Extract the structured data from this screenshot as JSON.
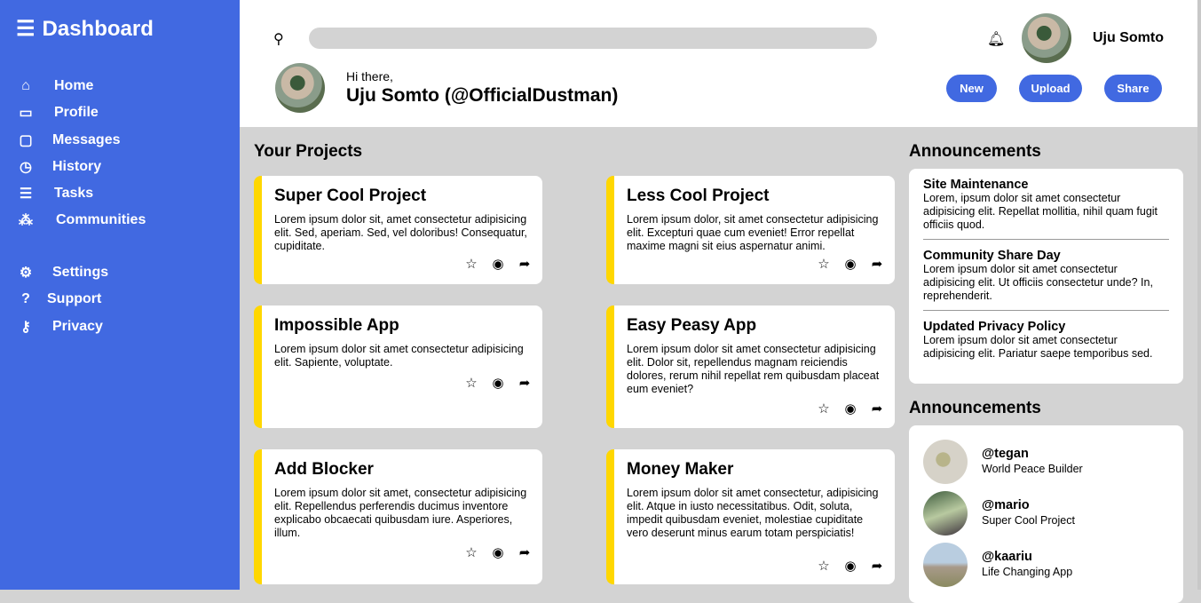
{
  "sidebar": {
    "title": "Dashboard",
    "menu_icon": "hamburger-icon",
    "items": [
      {
        "label": "Home",
        "icon": "home-icon"
      },
      {
        "label": "Profile",
        "icon": "id-card-icon"
      },
      {
        "label": "Messages",
        "icon": "message-icon"
      },
      {
        "label": "History",
        "icon": "clock-icon"
      },
      {
        "label": "Tasks",
        "icon": "tasks-icon"
      },
      {
        "label": "Communities",
        "icon": "people-icon"
      }
    ],
    "secondary": [
      {
        "label": "Settings",
        "icon": "gear-icon"
      },
      {
        "label": "Support",
        "icon": "question-icon"
      },
      {
        "label": "Privacy",
        "icon": "key-icon"
      }
    ]
  },
  "header": {
    "search_placeholder": "",
    "user_name": "Uju Somto",
    "greeting": "Hi there,",
    "full_name": "Uju Somto (@OfficialDustman)",
    "buttons": [
      "New",
      "Upload",
      "Share"
    ]
  },
  "projects": {
    "title": "Your Projects",
    "items": [
      {
        "title": "Super Cool Project",
        "desc": "Lorem ipsum dolor sit, amet consectetur adipisicing elit. Sed, aperiam. Sed, vel doloribus! Consequatur, cupiditate."
      },
      {
        "title": "Less Cool Project",
        "desc": "Lorem ipsum dolor, sit amet consectetur adipisicing elit. Excepturi quae cum eveniet! Error repellat maxime magni sit eius aspernatur animi."
      },
      {
        "title": "Impossible App",
        "desc": "Lorem ipsum dolor sit amet consectetur adipisicing elit. Sapiente, voluptate."
      },
      {
        "title": "Easy Peasy App",
        "desc": "Lorem ipsum dolor sit amet consectetur adipisicing elit. Dolor sit, repellendus magnam reiciendis dolores, rerum nihil repellat rem quibusdam placeat eum eveniet?"
      },
      {
        "title": "Add Blocker",
        "desc": "Lorem ipsum dolor sit amet, consectetur adipisicing elit. Repellendus perferendis ducimus inventore explicabo obcaecati quibusdam iure. Asperiores, illum."
      },
      {
        "title": "Money Maker",
        "desc": "Lorem ipsum dolor sit amet consectetur, adipisicing elit. Atque in iusto necessitatibus. Odit, soluta, impedit quibusdam eveniet, molestiae cupiditate vero deserunt minus earum totam perspiciatis!"
      }
    ]
  },
  "announcements": {
    "title": "Announcements",
    "items": [
      {
        "title": "Site Maintenance",
        "desc": "Lorem, ipsum dolor sit amet consectetur adipisicing elit. Repellat mollitia, nihil quam fugit officiis quod."
      },
      {
        "title": "Community Share Day",
        "desc": "Lorem ipsum dolor sit amet consectetur adipisicing elit. Ut officiis consectetur unde? In, reprehenderit."
      },
      {
        "title": "Updated Privacy Policy",
        "desc": "Lorem ipsum dolor sit amet consectetur adipisicing elit. Pariatur saepe temporibus sed."
      }
    ]
  },
  "trending": {
    "title": "Announcements",
    "items": [
      {
        "handle": "@tegan",
        "project": "World Peace Builder"
      },
      {
        "handle": "@mario",
        "project": "Super Cool Project"
      },
      {
        "handle": "@kaariu",
        "project": "Life Changing App"
      }
    ]
  },
  "colors": {
    "accent": "#4169e1",
    "card_border": "#ffd700",
    "background": "#d3d3d3"
  }
}
